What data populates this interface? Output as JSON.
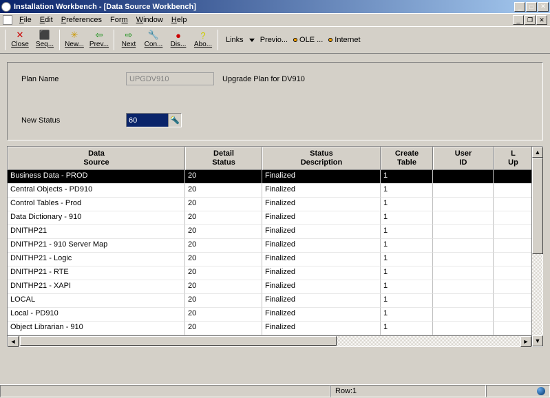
{
  "window": {
    "title": "Installation Workbench - [Data Source Workbench]"
  },
  "menu": {
    "file": "File",
    "edit": "Edit",
    "preferences": "Preferences",
    "form": "Form",
    "window": "Window",
    "help": "Help"
  },
  "toolbar": {
    "close": "Close",
    "seq": "Seq...",
    "new": "New...",
    "prev": "Prev...",
    "next": "Next",
    "con": "Con...",
    "dis": "Dis...",
    "abo": "Abo...",
    "links_label": "Links",
    "previo": "Previo...",
    "ole": "OLE ...",
    "internet": "Internet"
  },
  "icons": {
    "close": "✕",
    "seq": "⬛",
    "new": "✳",
    "prev": "⇦",
    "next": "⇨",
    "con": "🔧",
    "dis": "●",
    "abo": "?"
  },
  "form": {
    "plan_name_label": "Plan Name",
    "plan_name_value": "UPGDV910",
    "plan_desc": "Upgrade Plan for DV910",
    "new_status_label": "New Status",
    "new_status_value": "60"
  },
  "grid": {
    "headers": {
      "data_source": "Data\nSource",
      "detail_status": "Detail\nStatus",
      "status_description": "Status\nDescription",
      "create_table": "Create\nTable",
      "user_id": "User\nID",
      "last": "L\nUp"
    },
    "rows": [
      {
        "ds": "Business Data - PROD",
        "detail": "20",
        "desc": "Finalized",
        "ct": "1",
        "uid": ""
      },
      {
        "ds": "Central Objects - PD910",
        "detail": "20",
        "desc": "Finalized",
        "ct": "1",
        "uid": ""
      },
      {
        "ds": "Control Tables - Prod",
        "detail": "20",
        "desc": "Finalized",
        "ct": "1",
        "uid": ""
      },
      {
        "ds": "Data Dictionary - 910",
        "detail": "20",
        "desc": "Finalized",
        "ct": "1",
        "uid": ""
      },
      {
        "ds": "DNITHP21",
        "detail": "20",
        "desc": "Finalized",
        "ct": "1",
        "uid": ""
      },
      {
        "ds": "DNITHP21 - 910 Server Map",
        "detail": "20",
        "desc": "Finalized",
        "ct": "1",
        "uid": ""
      },
      {
        "ds": "DNITHP21 - Logic",
        "detail": "20",
        "desc": "Finalized",
        "ct": "1",
        "uid": ""
      },
      {
        "ds": "DNITHP21 - RTE",
        "detail": "20",
        "desc": "Finalized",
        "ct": "1",
        "uid": ""
      },
      {
        "ds": "DNITHP21 - XAPI",
        "detail": "20",
        "desc": "Finalized",
        "ct": "1",
        "uid": ""
      },
      {
        "ds": "LOCAL",
        "detail": "20",
        "desc": "Finalized",
        "ct": "1",
        "uid": ""
      },
      {
        "ds": "Local - PD910",
        "detail": "20",
        "desc": "Finalized",
        "ct": "1",
        "uid": ""
      },
      {
        "ds": "Object Librarian - 910",
        "detail": "20",
        "desc": "Finalized",
        "ct": "1",
        "uid": ""
      }
    ]
  },
  "status": {
    "row": "Row:1"
  }
}
